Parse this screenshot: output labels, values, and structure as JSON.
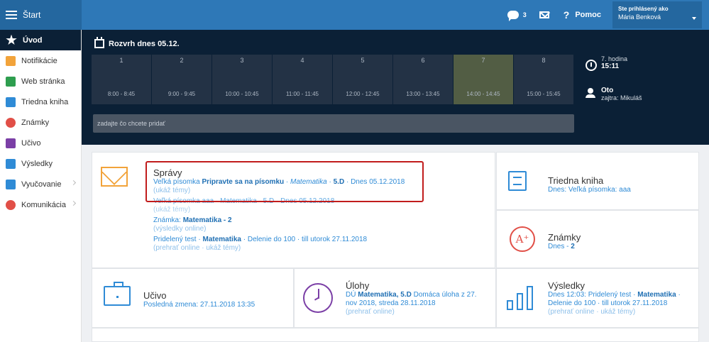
{
  "topbar": {
    "brand": "Štart",
    "chat_count": "3",
    "help_label": "Pomoc",
    "user_label": "Ste prihlásený ako",
    "user_name": "Mária Benková"
  },
  "sidebar": {
    "items": [
      {
        "label": "Úvod",
        "icon": "star-icon",
        "color": "#ffffff",
        "active": true
      },
      {
        "label": "Notifikácie",
        "icon": "envelope-icon",
        "color": "#f2a33a"
      },
      {
        "label": "Web stránka",
        "icon": "home-icon",
        "color": "#2e9e4f"
      },
      {
        "label": "Triedna kniha",
        "icon": "book-icon",
        "color": "#2f8bd6"
      },
      {
        "label": "Známky",
        "icon": "grade-icon",
        "color": "#e14f47"
      },
      {
        "label": "Učivo",
        "icon": "people-icon",
        "color": "#7b3fa6"
      },
      {
        "label": "Výsledky",
        "icon": "bars-icon",
        "color": "#2f8bd6"
      },
      {
        "label": "Vyučovanie",
        "icon": "folder-icon",
        "color": "#2f8bd6",
        "expandable": true
      },
      {
        "label": "Komunikácia",
        "icon": "chat-icon",
        "color": "#e14f47",
        "expandable": true
      }
    ]
  },
  "schedule": {
    "title": "Rozvrh dnes 05.12.",
    "slots": [
      {
        "num": "1",
        "time": "8:00 - 8:45"
      },
      {
        "num": "2",
        "time": "9:00 - 9:45"
      },
      {
        "num": "3",
        "time": "10:00 - 10:45"
      },
      {
        "num": "4",
        "time": "11:00 - 11:45"
      },
      {
        "num": "5",
        "time": "12:00 - 12:45"
      },
      {
        "num": "6",
        "time": "13:00 - 13:45"
      },
      {
        "num": "7",
        "time": "14:00 - 14:45",
        "current": true
      },
      {
        "num": "8",
        "time": "15:00 - 15:45"
      }
    ],
    "lesson_label": "7. hodina",
    "lesson_time": "15:11",
    "nameday_today": "Oto",
    "nameday_tomorrow": "zajtra: Mikuláš",
    "input_placeholder": "zadajte čo chcete pridať"
  },
  "news": {
    "title": "Správy",
    "r1_type": "Veľká písomka",
    "r1_title": "Pripravte sa na písomku",
    "r1_sep1": "·",
    "r1_subject": "Matematika",
    "r1_sep2": "·",
    "r1_class": "5.D",
    "r1_date": "· Dnes 05.12.2018",
    "r1_link": "(ukáž témy)",
    "r2_text": "Veľká písomka aaa · Matematika · 5.D · Dnes 05.12.2018",
    "r2_link": "(ukáž témy)",
    "r3_label": "Známka:",
    "r3_value": "Matematika - 2",
    "r3_link": "(výsledky online)",
    "r4_type": "Pridelený test ·",
    "r4_subject": "Matematika",
    "r4_rest": "· Delenie do 100 · till utorok 27.11.2018",
    "r4_link": "(prehrať online · ukáž témy)"
  },
  "triedna": {
    "title": "Triedna kniha",
    "text": "Dnes: Veľká písomka: aaa"
  },
  "znamky": {
    "title": "Známky",
    "text_prefix": "Dnes -",
    "text_value": "2",
    "icon_glyph": "A⁺"
  },
  "ucivo": {
    "title": "Učivo",
    "text": "Posledná zmena: 27.11.2018 13:35"
  },
  "ulohy": {
    "title": "Úlohy",
    "l1_prefix": "DÚ",
    "l1_subject": "Matematika, 5.D",
    "l1_rest": "Domáca úloha z 27.",
    "l2": "nov 2018, streda 28.11.2018",
    "l3": "(prehrať online)"
  },
  "vysledky": {
    "title": "Výsledky",
    "l1_prefix": "Dnes 12:03: Pridelený test ·",
    "l1_subject": "Matematika",
    "l1_suffix": "·",
    "l2": "Delenie do 100 · till utorok 27.11.2018",
    "l3": "(prehrať online · ukáž témy)"
  }
}
